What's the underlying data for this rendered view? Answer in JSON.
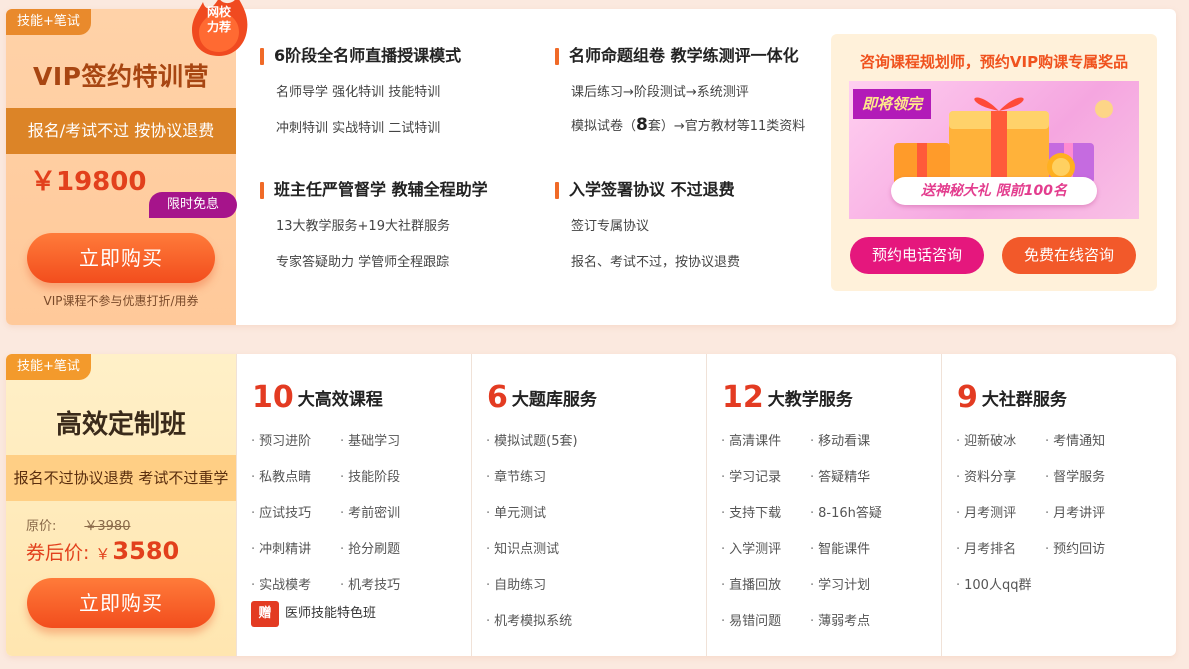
{
  "vip": {
    "tag": "技能+笔试",
    "flame_badge": [
      "网校",
      "力荐"
    ],
    "title": "VIP签约特训营",
    "band": "报名/考试不过 按协议退费",
    "price": "￥19800",
    "limit_badge": "限时免息",
    "buy_label": "立即购买",
    "note": "VIP课程不参与优惠打折/用券"
  },
  "features": [
    {
      "head": "6阶段全名师直播授课模式",
      "lines": [
        "名师导学 强化特训 技能特训",
        "冲刺特训 实战特训 二试特训"
      ]
    },
    {
      "head": "名师命题组卷 教学练测评一体化",
      "lines": [
        "课后练习→阶段测试→系统测评"
      ],
      "mock": {
        "pre": "模拟试卷（",
        "num": "8",
        "post": "套）→官方教材等11类资料"
      }
    },
    {
      "head": "班主任严管督学 教辅全程助学",
      "lines": [
        "13大教学服务+19大社群服务",
        "专家答疑助力 学管师全程跟踪"
      ]
    },
    {
      "head": "入学签署协议 不过退费",
      "lines": [
        "签订专属协议",
        "报名、考试不过，按协议退费"
      ]
    }
  ],
  "consult": {
    "title": "咨询课程规划师，预约VIP购课专属奖品",
    "banner_badge": "即将领完",
    "banner_pill": "送神秘大礼 限前100名",
    "phone_btn": "预约电话咨询",
    "online_btn": "免费在线咨询"
  },
  "custom": {
    "tag": "技能+笔试",
    "title": "高效定制班",
    "band": "报名不过协议退费 考试不过重学",
    "orig_label": "原价:",
    "orig_price": "￥3980",
    "coupon_label": "券后价:",
    "coupon_yen": "￥",
    "coupon_price": "3580",
    "buy_label": "立即购买"
  },
  "columns": [
    {
      "num": "10",
      "label": "大高效课程",
      "items": [
        "预习进阶",
        "基础学习",
        "私教点睛",
        "技能阶段",
        "应试技巧",
        "考前密训",
        "冲刺精讲",
        "抢分刷题",
        "实战模考",
        "机考技巧"
      ],
      "gift_icon": "赠",
      "gift": "医师技能特色班"
    },
    {
      "num": "6",
      "label": "大题库服务",
      "items": [
        "模拟试题(5套)",
        "章节练习",
        "单元测试",
        "知识点测试",
        "自助练习",
        "机考模拟系统"
      ]
    },
    {
      "num": "12",
      "label": "大教学服务",
      "items": [
        "高清课件",
        "移动看课",
        "学习记录",
        "答疑精华",
        "支持下载",
        "8-16h答疑",
        "入学测评",
        "智能课件",
        "直播回放",
        "学习计划",
        "易错问题",
        "薄弱考点"
      ]
    },
    {
      "num": "9",
      "label": "大社群服务",
      "items": [
        "迎新破冰",
        "考情通知",
        "资料分享",
        "督学服务",
        "月考测评",
        "月考讲评",
        "月考排名",
        "预约回访",
        "100人qq群"
      ]
    }
  ],
  "colors": {
    "accent": "#f06a28",
    "price_red": "#e2401c",
    "magenta": "#e5177d"
  }
}
